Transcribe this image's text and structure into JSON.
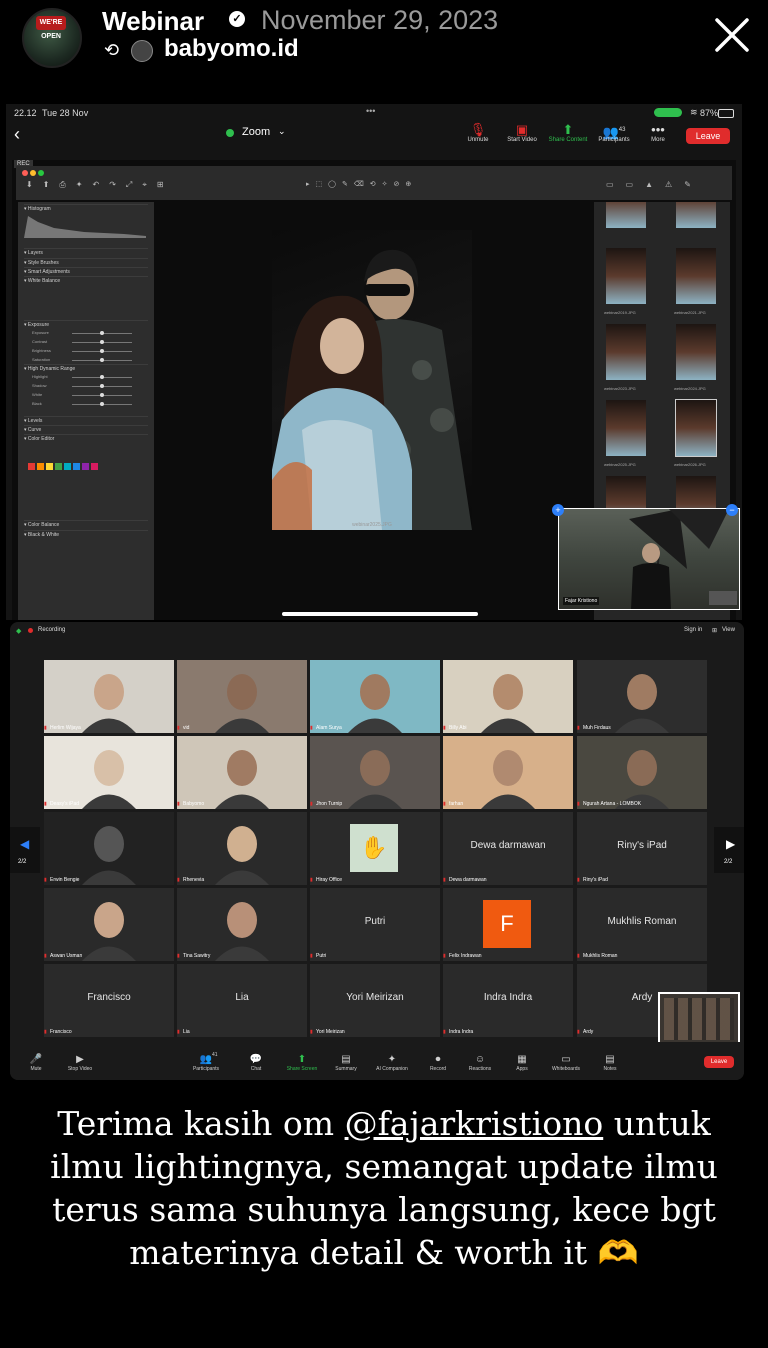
{
  "story": {
    "title": "Webinar",
    "date": "November 29, 2023",
    "reposted_from": "babyomo.id",
    "avatar_badge": "WE'RE OPEN",
    "caption_line1_pre": "Terima kasih om ",
    "caption_mention": "@fajarkristiono",
    "caption_line1_post": " untuk",
    "caption_line2": "ilmu lightingnya, semangat update ilmu",
    "caption_line3": "terus sama suhunya langsung, kece bgt",
    "caption_line4": "materinya detail & worth it",
    "caption_emoji": "🫶"
  },
  "ipad": {
    "time": "22.12",
    "date": "Tue 28 Nov",
    "battery": "87%",
    "zoom_title": "Zoom",
    "toolbar": [
      "Unmute",
      "Start Video",
      "Share Content",
      "Participants",
      "More"
    ],
    "participants_count": "43",
    "leave": "Leave",
    "rec": "REC",
    "photo_caption": "webinar2025.JPG",
    "presenter_name": "Fajar Kristiono",
    "thumb_labels": [
      "webinar2019.JPG",
      "webinar2021.JPG",
      "webinar2023.JPG",
      "webinar2024.JPG",
      "webinar2025.JPG",
      "webinar2026.JPG"
    ],
    "left_panel_sections": [
      "Histogram",
      "Layers",
      "Style Brushes",
      "Smart Adjustments",
      "White Balance",
      "Exposure",
      "High Dynamic Range",
      "Levels",
      "Curve",
      "Color Editor",
      "Color Balance",
      "Black & White"
    ],
    "hdr_items": [
      "Highlight",
      "Shadow",
      "White",
      "Black"
    ],
    "exposure_items": [
      "Exposure",
      "Contrast",
      "Brightness",
      "Saturation"
    ]
  },
  "gallery": {
    "recording": "Recording",
    "sign_in": "Sign in",
    "view": "View",
    "page_left": "2/2",
    "page_right": "2/2",
    "tiles": [
      {
        "name": "Herlim Wijaya",
        "big": ""
      },
      {
        "name": "vid",
        "big": ""
      },
      {
        "name": "Alam Surya",
        "big": ""
      },
      {
        "name": "Billy Abi",
        "big": ""
      },
      {
        "name": "Muh Firdaus",
        "big": ""
      },
      {
        "name": "Deasy's iPad",
        "big": ""
      },
      {
        "name": "Babyomo",
        "big": ""
      },
      {
        "name": "Jhon Turnip",
        "big": ""
      },
      {
        "name": "farhan",
        "big": ""
      },
      {
        "name": "Ngurah Artana - LOMBOK",
        "big": ""
      },
      {
        "name": "Erwin Bengie",
        "big": ""
      },
      {
        "name": "Rhenevia",
        "big": ""
      },
      {
        "name": "Hiray Office",
        "big": ""
      },
      {
        "name": "Dewa darmawan",
        "big": "Dewa darmawan"
      },
      {
        "name": "Riny's iPad",
        "big": "Riny's iPad"
      },
      {
        "name": "Aswan Usman",
        "big": ""
      },
      {
        "name": "Tina Sawitry",
        "big": ""
      },
      {
        "name": "Putri",
        "big": "Putri"
      },
      {
        "name": "Felix Indrawan",
        "big": ""
      },
      {
        "name": "Mukhlis Roman",
        "big": "Mukhlis Roman"
      },
      {
        "name": "Francisco",
        "big": "Francisco"
      },
      {
        "name": "Lia",
        "big": "Lia"
      },
      {
        "name": "Yori Meirizan",
        "big": "Yori Meirizan"
      },
      {
        "name": "Indra Indra",
        "big": "Indra Indra"
      },
      {
        "name": "Ardy",
        "big": "Ardy"
      }
    ],
    "felix_letter": "F",
    "bottom": [
      "Mute",
      "Stop Video",
      "Participants",
      "Chat",
      "Share Screen",
      "Summary",
      "AI Companion",
      "Record",
      "Reactions",
      "Apps",
      "Whiteboards",
      "Notes"
    ],
    "participants_count": "41",
    "leave": "Leave"
  }
}
